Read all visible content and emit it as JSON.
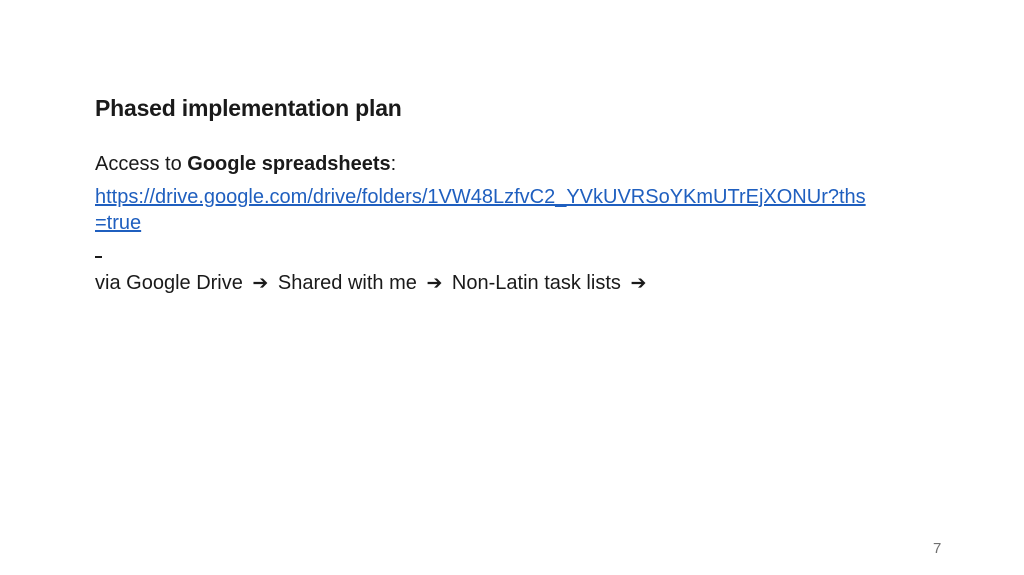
{
  "slide": {
    "title": "Phased implementation plan",
    "access": {
      "prefix": "Access to ",
      "bold": "Google spreadsheets",
      "suffix": ":"
    },
    "link_text": "https://drive.google.com/drive/folders/1VW48LzfvC2_YVkUVRSoYKmUTrEjXONUr?ths=true",
    "bullet_dash": "-",
    "path": {
      "prefix": "via",
      "steps": [
        "Google Drive",
        "Shared with me",
        "Non-Latin task lists"
      ],
      "arrow_icon": "arrow-right-icon"
    },
    "page_number": "7"
  },
  "colors": {
    "text": "#1a1a1a",
    "link": "#1f5fbf",
    "page_number": "#707070"
  }
}
